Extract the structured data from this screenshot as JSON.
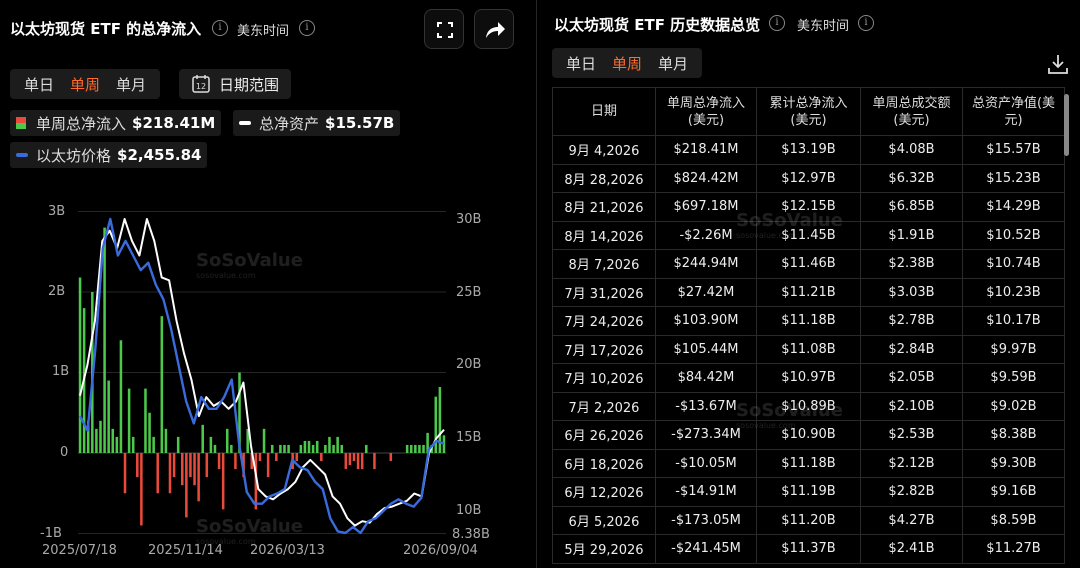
{
  "left": {
    "title": "以太坊现货 ETF 的总净流入",
    "timezone": "美东时间",
    "tabs": [
      "单日",
      "单周",
      "单月"
    ],
    "active_tab": "单周",
    "date_range_label": "日期范围",
    "calendar_day": "12",
    "legend": [
      {
        "label": "单周总净流入",
        "value": "$218.41M"
      },
      {
        "label": "总净资产",
        "value": "$15.57B"
      },
      {
        "label": "以太坊价格",
        "value": "$2,455.84"
      }
    ],
    "watermark": {
      "brand": "SoSoValue",
      "site": "sosovalue.com"
    }
  },
  "chart_data": {
    "type": "bar",
    "left_axis": {
      "ticks": [
        "3B",
        "2B",
        "1B",
        "0",
        "-1B"
      ],
      "range": [
        -1,
        3
      ],
      "unit": "B"
    },
    "right_axis": {
      "ticks": [
        "30B",
        "25B",
        "20B",
        "15B",
        "10B",
        "8.38B"
      ],
      "range": [
        8.38,
        30
      ],
      "unit": "B"
    },
    "x_ticks": [
      "2025/07/18",
      "2025/11/14",
      "2026/03/13",
      "2026/09/04"
    ],
    "series": [
      {
        "name": "单周总净流入",
        "type": "bar",
        "unit": "B",
        "color_pos": "#4cc94a",
        "color_neg": "#e84a3c",
        "values": [
          2.18,
          1.8,
          0.4,
          2.0,
          0.3,
          0.4,
          2.8,
          0.9,
          0.3,
          0.2,
          1.4,
          -0.5,
          0.8,
          0.2,
          -0.3,
          -0.9,
          0.8,
          0.5,
          0.2,
          -0.5,
          1.7,
          0.3,
          -0.5,
          -0.3,
          0.2,
          -0.4,
          -0.8,
          -0.3,
          -0.4,
          -0.6,
          0.35,
          -0.3,
          0.2,
          0.1,
          -0.2,
          -0.7,
          0.3,
          0.1,
          -0.2,
          1.0,
          -0.3,
          0.3,
          -0.2,
          -0.7,
          -0.1,
          0.3,
          -0.3,
          0.1,
          -0.1,
          0.1,
          0.1,
          0.1,
          -0.2,
          -0.1,
          0.1,
          0.15,
          0.15,
          0.1,
          0.15,
          -0.1,
          0.1,
          0.2,
          0.1,
          0.2,
          0.1,
          -0.2,
          -0.15,
          -0.1,
          -0.2,
          -0.2,
          0.1,
          0.0,
          -0.2,
          0.0,
          0.0,
          0.0,
          -0.1,
          0.0,
          0.0,
          0.0,
          0.1,
          0.1,
          0.1,
          0.1,
          0.1,
          0.25,
          0.1,
          0.7,
          0.82,
          0.22
        ]
      },
      {
        "name": "总净资产",
        "type": "line",
        "unit": "B",
        "color": "#ffffff",
        "values": [
          17.9,
          20.0,
          23.0,
          28.5,
          29.2,
          28.0,
          30.0,
          28.5,
          27.5,
          30.0,
          28.5,
          26.0,
          25.8,
          23.0,
          20.8,
          19.0,
          16.5,
          17.8,
          17.2,
          17.5,
          17.0,
          17.5,
          18.8,
          14.5,
          11.5,
          11.0,
          10.8,
          11.2,
          11.5,
          12.0,
          13.0,
          13.5,
          13.0,
          12.5,
          11.0,
          10.5,
          9.5,
          9.0,
          9.3,
          9.2,
          9.8,
          10.2,
          10.3,
          10.5,
          10.7,
          11.2,
          11.0,
          14.0,
          15.0,
          15.57
        ]
      },
      {
        "name": "以太坊价格",
        "type": "line",
        "unit": "B",
        "color": "#3a6bdc",
        "values": [
          16.5,
          15.5,
          21.0,
          28.0,
          30.0,
          27.5,
          28.5,
          27.5,
          26.5,
          27.0,
          25.5,
          24.5,
          22.5,
          20.0,
          17.5,
          16.0,
          17.8,
          17.0,
          17.0,
          17.8,
          19.0,
          14.5,
          11.3,
          10.5,
          10.5,
          11.0,
          11.2,
          11.5,
          13.5,
          13.0,
          12.8,
          12.0,
          11.5,
          9.5,
          8.6,
          8.5,
          8.9,
          8.5,
          9.3,
          9.5,
          10.0,
          10.5,
          10.8,
          10.5,
          10.3,
          10.9,
          14.2,
          14.8,
          14.6
        ]
      }
    ]
  },
  "right": {
    "title": "以太坊现货 ETF 历史数据总览",
    "timezone": "美东时间",
    "tabs": [
      "单日",
      "单周",
      "单月"
    ],
    "active_tab": "单周",
    "headers": [
      "日期",
      "单周总净流入\n(美元)",
      "累计总净流入\n(美元)",
      "单周总成交额\n(美元)",
      "总资产净值(美\n元)"
    ],
    "rows": [
      [
        "9月 4,2026",
        "$218.41M",
        "$13.19B",
        "$4.08B",
        "$15.57B"
      ],
      [
        "8月 28,2026",
        "$824.42M",
        "$12.97B",
        "$6.32B",
        "$15.23B"
      ],
      [
        "8月 21,2026",
        "$697.18M",
        "$12.15B",
        "$6.85B",
        "$14.29B"
      ],
      [
        "8月 14,2026",
        "-$2.26M",
        "$11.45B",
        "$1.91B",
        "$10.52B"
      ],
      [
        "8月 7,2026",
        "$244.94M",
        "$11.46B",
        "$2.38B",
        "$10.74B"
      ],
      [
        "7月 31,2026",
        "$27.42M",
        "$11.21B",
        "$3.03B",
        "$10.23B"
      ],
      [
        "7月 24,2026",
        "$103.90M",
        "$11.18B",
        "$2.78B",
        "$10.17B"
      ],
      [
        "7月 17,2026",
        "$105.44M",
        "$11.08B",
        "$2.84B",
        "$9.97B"
      ],
      [
        "7月 10,2026",
        "$84.42M",
        "$10.97B",
        "$2.05B",
        "$9.59B"
      ],
      [
        "7月 2,2026",
        "-$13.67M",
        "$10.89B",
        "$2.10B",
        "$9.02B"
      ],
      [
        "6月 26,2026",
        "-$273.34M",
        "$10.90B",
        "$2.53B",
        "$8.38B"
      ],
      [
        "6月 18,2026",
        "-$10.05M",
        "$11.18B",
        "$2.12B",
        "$9.30B"
      ],
      [
        "6月 12,2026",
        "-$14.91M",
        "$11.19B",
        "$2.82B",
        "$9.16B"
      ],
      [
        "6月 5,2026",
        "-$173.05M",
        "$11.20B",
        "$4.27B",
        "$8.59B"
      ],
      [
        "5月 29,2026",
        "-$241.45M",
        "$11.37B",
        "$2.41B",
        "$11.27B"
      ]
    ],
    "watermark": {
      "brand": "SoSoValue",
      "site": "sosovalue.com"
    }
  },
  "colors": {
    "accent": "#ff6a2d",
    "positive": "#3fd05a",
    "negative": "#f1443c",
    "price_line": "#3a6bdc"
  }
}
